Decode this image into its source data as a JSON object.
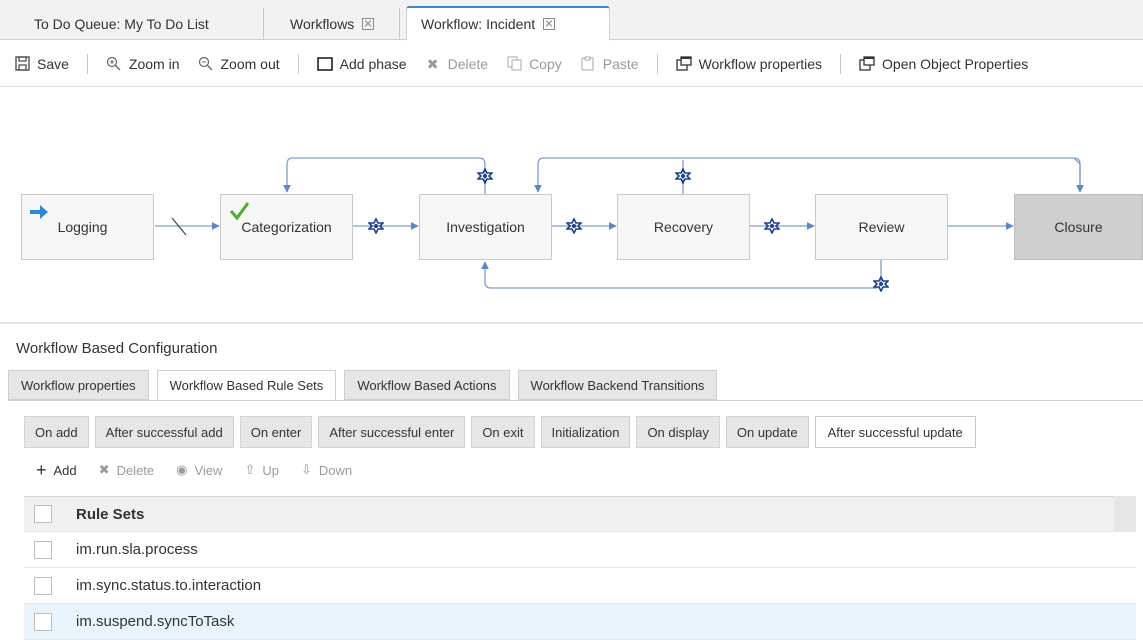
{
  "top_tabs": [
    {
      "label": "To Do Queue: My To Do List"
    },
    {
      "label": "Workflows"
    },
    {
      "label": "Workflow: Incident"
    }
  ],
  "toolbar": {
    "save": "Save",
    "zoom_in": "Zoom in",
    "zoom_out": "Zoom out",
    "add_phase": "Add phase",
    "delete": "Delete",
    "copy": "Copy",
    "paste": "Paste",
    "workflow_properties": "Workflow properties",
    "open_object_properties": "Open Object Properties"
  },
  "workflow": {
    "phases": [
      {
        "label": "Logging"
      },
      {
        "label": "Categorization"
      },
      {
        "label": "Investigation"
      },
      {
        "label": "Recovery"
      },
      {
        "label": "Review"
      },
      {
        "label": "Closure"
      }
    ]
  },
  "config": {
    "title": "Workflow Based Configuration",
    "tabs": [
      {
        "label": "Workflow properties"
      },
      {
        "label": "Workflow Based Rule Sets"
      },
      {
        "label": "Workflow Based Actions"
      },
      {
        "label": "Workflow Backend Transitions"
      }
    ],
    "subtabs": [
      {
        "label": "On add"
      },
      {
        "label": "After successful add"
      },
      {
        "label": "On enter"
      },
      {
        "label": "After successful enter"
      },
      {
        "label": "On exit"
      },
      {
        "label": "Initialization"
      },
      {
        "label": "On display"
      },
      {
        "label": "On update"
      },
      {
        "label": "After successful update"
      }
    ],
    "actions": {
      "add": "Add",
      "delete": "Delete",
      "view": "View",
      "up": "Up",
      "down": "Down"
    },
    "table": {
      "header": "Rule Sets",
      "rows": [
        {
          "value": "im.run.sla.process"
        },
        {
          "value": "im.sync.status.to.interaction"
        },
        {
          "value": "im.suspend.syncToTask"
        }
      ]
    }
  },
  "colors": {
    "accent": "#3a86c8",
    "link_line": "#7f9fcc",
    "gear": "#1f3f8f",
    "check": "#4caf2a",
    "arrow": "#2a8ad8"
  }
}
